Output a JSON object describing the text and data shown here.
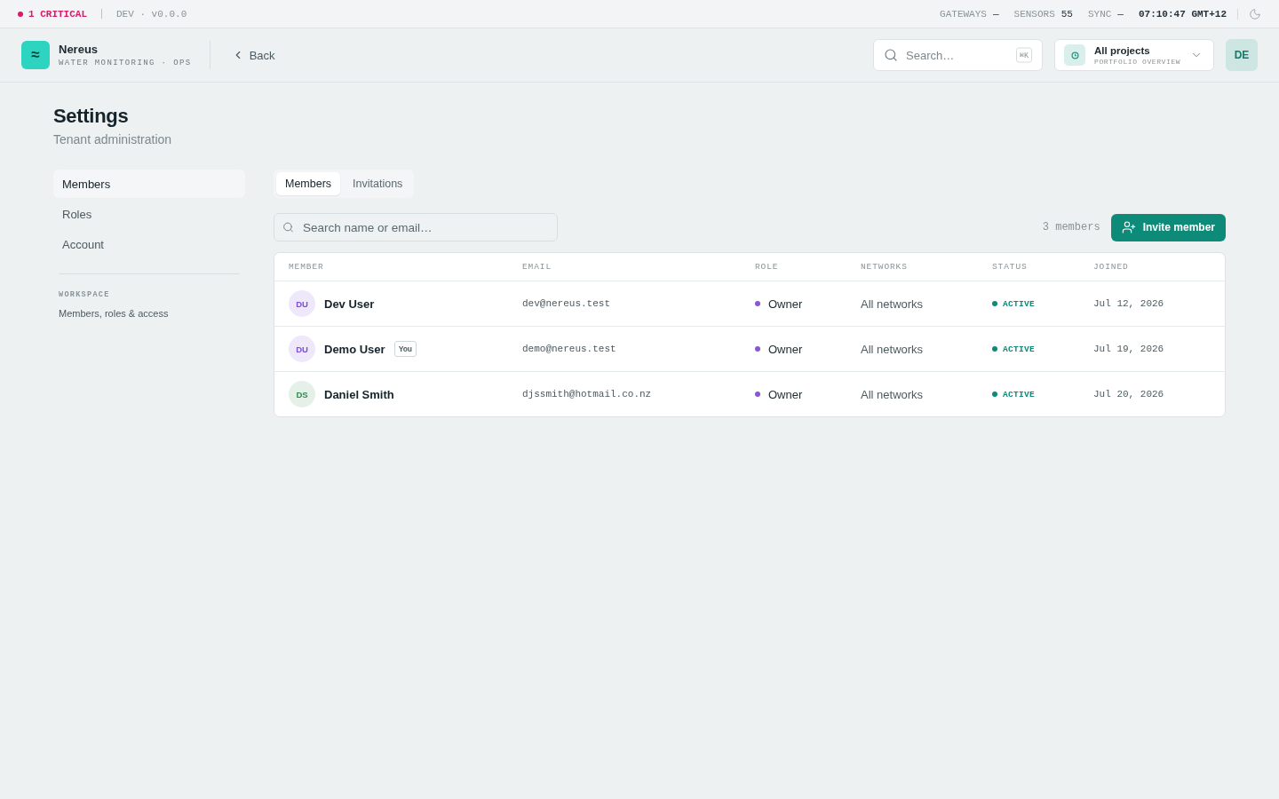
{
  "status_bar": {
    "alert": "1 CRITICAL",
    "environment": "DEV · v0.0.0",
    "stats": [
      {
        "label": "GATEWAYS",
        "value": "—"
      },
      {
        "label": "SENSORS",
        "value": "55"
      },
      {
        "label": "SYNC",
        "value": "—"
      }
    ],
    "clock": "07:10:47 GMT+12"
  },
  "header": {
    "logo_glyph": "≈",
    "brand": "Nereus",
    "tagline": "WATER MONITORING · OPS",
    "back": "Back",
    "search": {
      "placeholder": "Search…",
      "shortcut": "⌘K"
    },
    "project": {
      "name": "All projects",
      "subtitle": "PORTFOLIO OVERVIEW"
    },
    "user_initials": "DE"
  },
  "page": {
    "title": "Settings",
    "subtitle": "Tenant administration"
  },
  "sidebar": {
    "items": [
      {
        "label": "Members",
        "selected": true
      },
      {
        "label": "Roles",
        "selected": false
      },
      {
        "label": "Account",
        "selected": false
      }
    ],
    "section": {
      "heading": "WORKSPACE",
      "description": "Members, roles & access"
    }
  },
  "tabs": [
    {
      "label": "Members",
      "selected": true
    },
    {
      "label": "Invitations",
      "selected": false
    }
  ],
  "toolbar": {
    "search": {
      "placeholder": "Search name or email…"
    },
    "count": "3 members",
    "invite_button": "Invite member"
  },
  "table": {
    "columns": [
      "MEMBER",
      "EMAIL",
      "ROLE",
      "NETWORKS",
      "STATUS",
      "JOINED"
    ],
    "rows": [
      {
        "initials": "DU",
        "color": "#7c4dd8",
        "name": "Dev User",
        "email": "dev@nereus.test",
        "role": "Owner",
        "networks": "All networks",
        "status": "ACTIVE",
        "joined": "Jul 12, 2026"
      },
      {
        "initials": "DU",
        "color": "#7c4dd8",
        "name": "Demo User",
        "badge": "You",
        "email": "demo@nereus.test",
        "role": "Owner",
        "networks": "All networks",
        "status": "ACTIVE",
        "joined": "Jul 19, 2026"
      },
      {
        "initials": "DS",
        "color": "#2f8a4f",
        "name": "Daniel Smith",
        "email": "djssmith@hotmail.co.nz",
        "role": "Owner",
        "networks": "All networks",
        "status": "ACTIVE",
        "joined": "Jul 20, 2026"
      }
    ]
  }
}
